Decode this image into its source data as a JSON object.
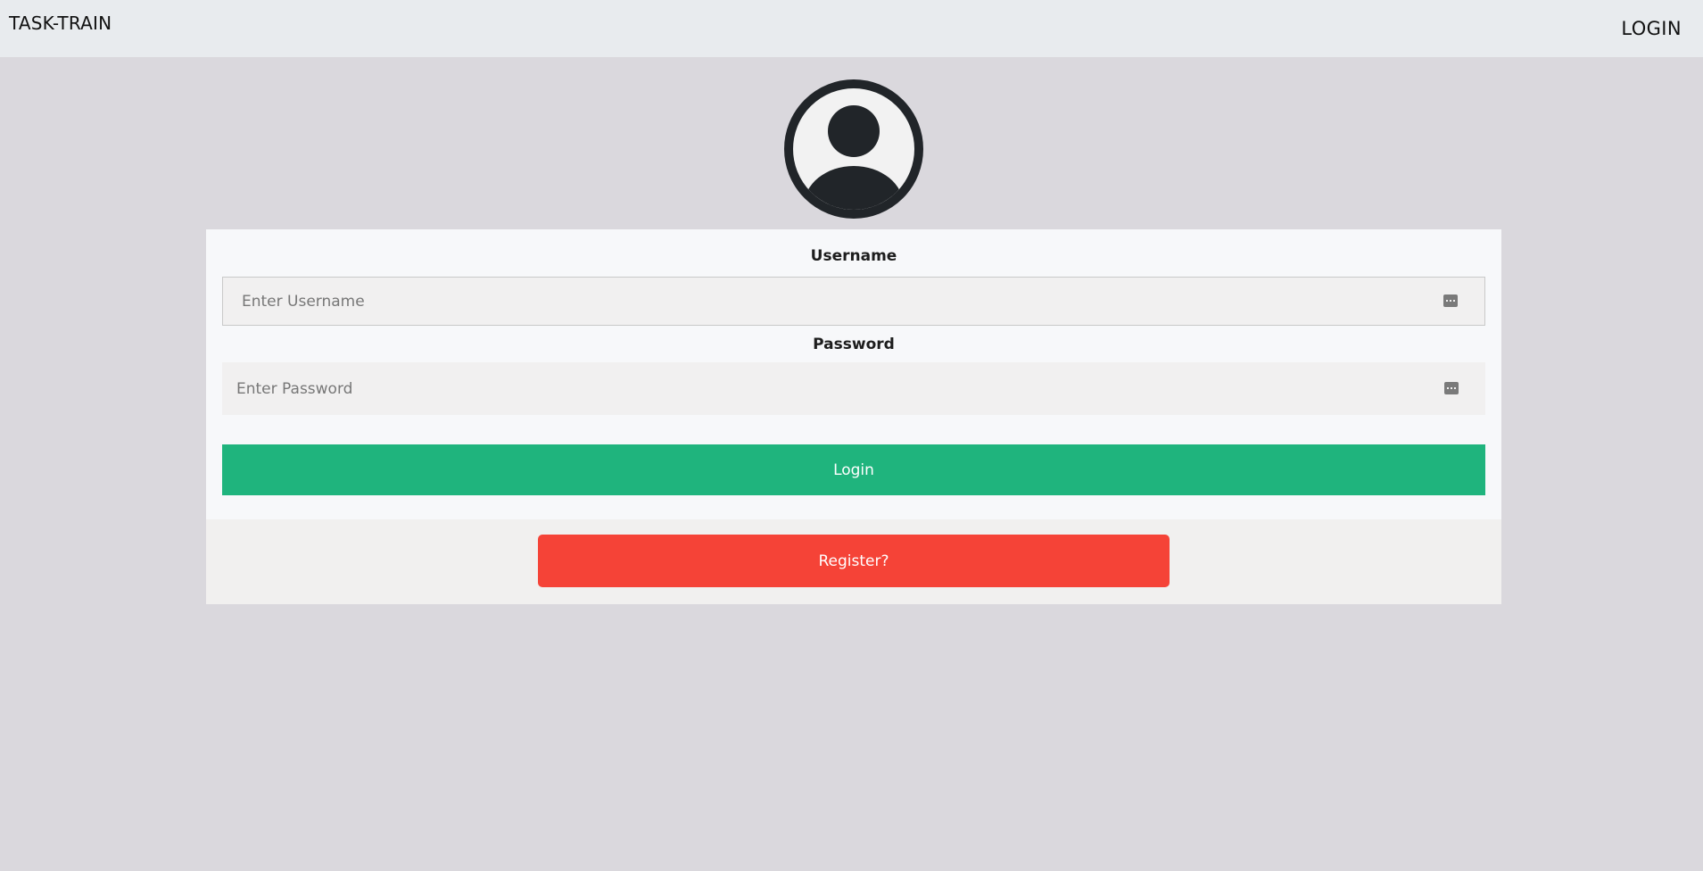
{
  "navbar": {
    "brand": "TASK-TRAIN",
    "login_link": "LOGIN"
  },
  "avatar": {
    "icon": "user-circle-icon"
  },
  "form": {
    "username_label": "Username",
    "username_placeholder": "Enter Username",
    "username_value": "",
    "password_label": "Password",
    "password_placeholder": "Enter Password",
    "password_value": "",
    "field_icon": "password-manager-icon",
    "login_button": "Login",
    "register_button": "Register?"
  },
  "colors": {
    "page_background": "#dad8dd",
    "navbar_background": "#e8ebee",
    "login_button": "#1fb47d",
    "register_button": "#f54337"
  }
}
